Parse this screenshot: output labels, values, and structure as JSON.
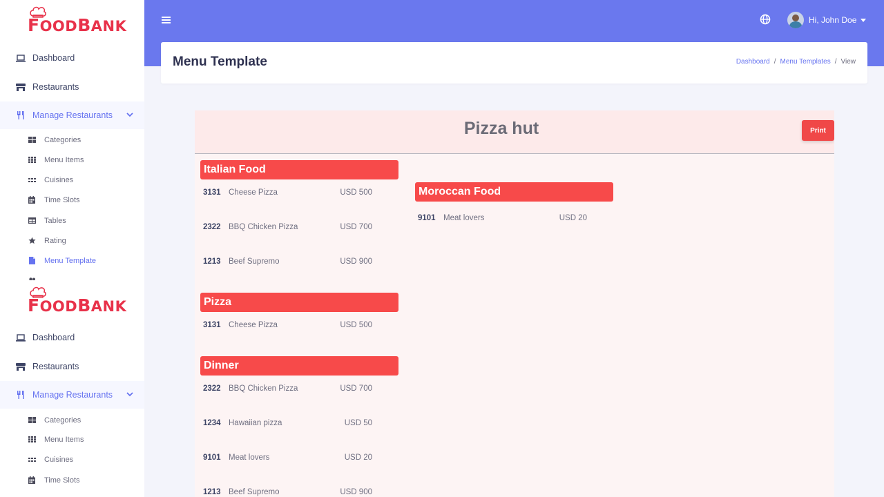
{
  "brand": {
    "name_first": "F",
    "name_rest": "OOD",
    "name_second": "B",
    "name_last": "ANK"
  },
  "topbar": {
    "user_label": "Hi, John Doe"
  },
  "sidebar": {
    "items": [
      {
        "label": "Dashboard",
        "icon": "laptop-icon"
      },
      {
        "label": "Restaurants",
        "icon": "store-icon"
      },
      {
        "label": "Manage Restaurants",
        "icon": "utensils-icon"
      }
    ],
    "subitems": [
      {
        "label": "Categories",
        "icon": "grid-icon"
      },
      {
        "label": "Menu Items",
        "icon": "th-icon"
      },
      {
        "label": "Cuisines",
        "icon": "dots-icon"
      },
      {
        "label": "Time Slots",
        "icon": "calendar-icon"
      },
      {
        "label": "Tables",
        "icon": "table-icon"
      },
      {
        "label": "Rating",
        "icon": "star-icon"
      },
      {
        "label": "Menu Template",
        "icon": "file-icon"
      }
    ]
  },
  "page": {
    "title": "Menu Template",
    "breadcrumb": [
      "Dashboard",
      "Menu Templates",
      "View"
    ],
    "separator": "/"
  },
  "menu": {
    "restaurant": "Pizza hut",
    "print_label": "Print",
    "sections_left": [
      {
        "title": "Italian Food",
        "items": [
          {
            "code": "3131",
            "name": "Cheese Pizza",
            "price": "USD 500"
          },
          {
            "code": "2322",
            "name": "BBQ Chicken Pizza",
            "price": "USD 700"
          },
          {
            "code": "1213",
            "name": "Beef Supremo",
            "price": "USD 900"
          }
        ]
      },
      {
        "title": "Pizza",
        "items": [
          {
            "code": "3131",
            "name": "Cheese Pizza",
            "price": "USD 500"
          }
        ]
      },
      {
        "title": "Dinner",
        "items": [
          {
            "code": "2322",
            "name": "BBQ Chicken Pizza",
            "price": "USD 700"
          },
          {
            "code": "1234",
            "name": "Hawaiian pizza",
            "price": "USD 50"
          },
          {
            "code": "9101",
            "name": "Meat lovers",
            "price": "USD 20"
          },
          {
            "code": "1213",
            "name": "Beef Supremo",
            "price": "USD 900"
          }
        ]
      }
    ],
    "sections_right": [
      {
        "title": "Moroccan Food",
        "items": [
          {
            "code": "9101",
            "name": "Meat lovers",
            "price": "USD 20"
          }
        ]
      }
    ]
  },
  "colors": {
    "accent": "#6a78ee",
    "brand": "#e8324a",
    "section": "#f74a4a"
  }
}
